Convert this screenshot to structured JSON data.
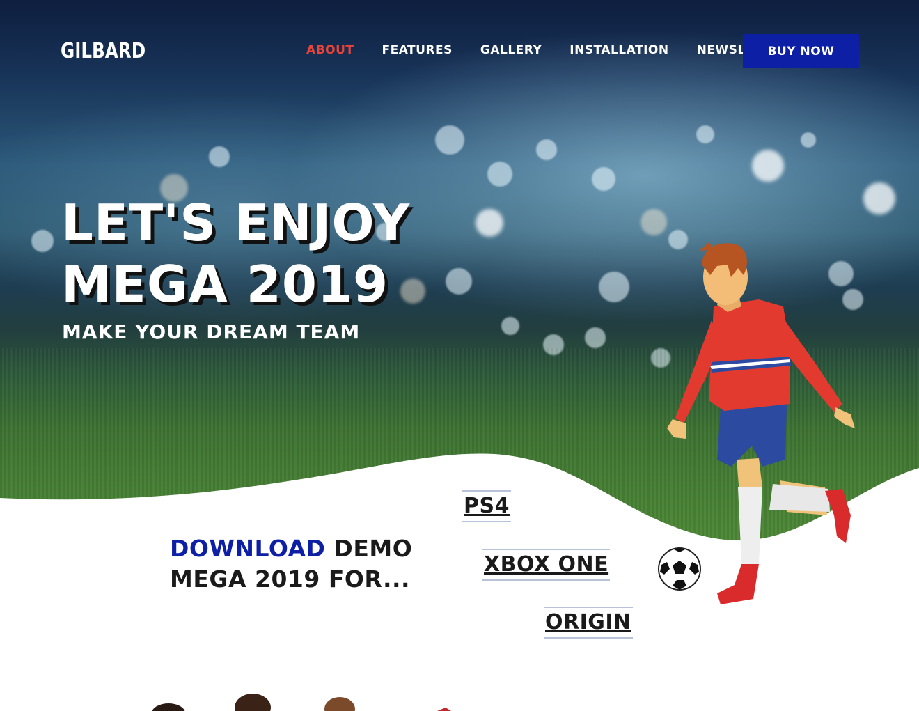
{
  "brand": {
    "logo": "GILBARD"
  },
  "nav": {
    "items": [
      {
        "label": "ABOUT",
        "active": true
      },
      {
        "label": "FEATURES",
        "active": false
      },
      {
        "label": "GALLERY",
        "active": false
      },
      {
        "label": "INSTALLATION",
        "active": false
      },
      {
        "label": "NEWSLATTER",
        "active": false
      }
    ],
    "cta": "BUY NOW"
  },
  "hero": {
    "title_line1": "LET'S ENJOY",
    "title_line2": "MEGA 2019",
    "subtitle": "MAKE YOUR DREAM TEAM"
  },
  "download": {
    "highlight": "DOWNLOAD",
    "line1_rest": "DEMO",
    "line2": "MEGA 2019 FOR..."
  },
  "platforms": [
    "PS4",
    "XBOX ONE",
    "ORIGIN"
  ],
  "colors": {
    "accent_red": "#e8443a",
    "brand_blue": "#0d1fa4",
    "text_dark": "#1a1a1a"
  },
  "icons": [
    "soccer-player-illustration",
    "soccer-ball-icon"
  ]
}
